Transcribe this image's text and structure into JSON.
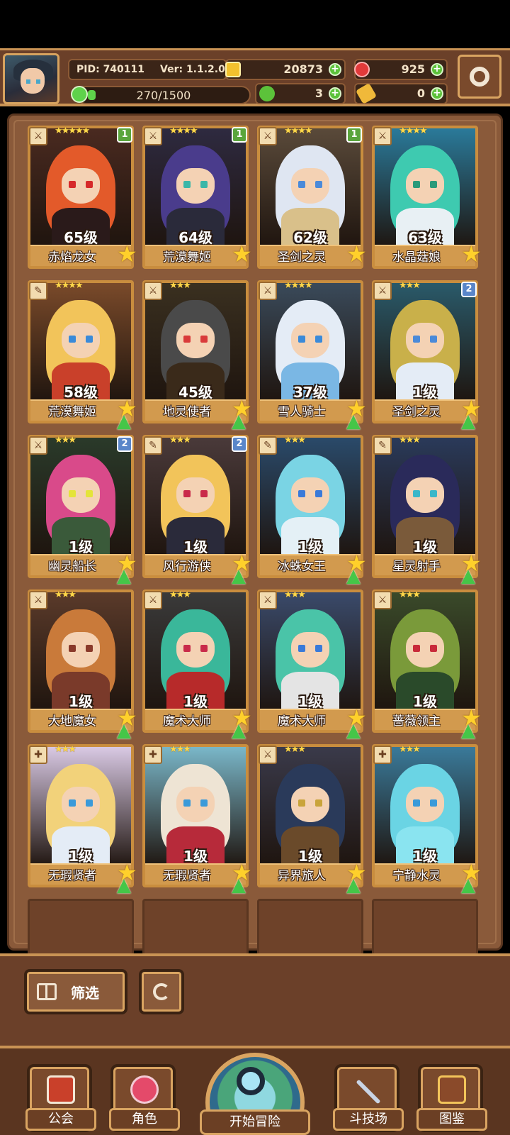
{
  "header": {
    "pid": "PID: 740111",
    "version": "Ver: 1.1.2.0",
    "gold": "20873",
    "gems": "925",
    "exp": "270/1500",
    "exp_progress": 0.18,
    "clover": "3",
    "key": "0",
    "colors": {
      "gold": "#f2c12e",
      "gem": "#e23a3a",
      "clover": "#5cc23a",
      "key": "#f0b93a"
    }
  },
  "heroes": [
    {
      "name": "赤焰龙女",
      "level": "65级",
      "stars": "★★★★★",
      "badge": "1",
      "badge_color": "green",
      "class_icon": "sword-icon",
      "hair": "#e35a2a",
      "eye": "#d62a2a",
      "outfit": "#2a1a1a",
      "bg": "#4a2a20"
    },
    {
      "name": "荒漠舞姬",
      "level": "64级",
      "stars": "★★★★",
      "badge": "1",
      "badge_color": "green",
      "class_icon": "sword-icon",
      "hair": "#4a3c8c",
      "eye": "#3ab7a8",
      "outfit": "#2a2a3a",
      "bg": "#2e2a40"
    },
    {
      "name": "圣剑之灵",
      "level": "62级",
      "stars": "★★★★",
      "badge": "1",
      "badge_color": "green",
      "class_icon": "sword-icon",
      "hair": "#dfe6f2",
      "eye": "#4a8ad9",
      "outfit": "#d9c08a",
      "bg": "#5a4a3a"
    },
    {
      "name": "水晶菇娘",
      "level": "63级",
      "stars": "★★★★",
      "badge": "",
      "badge_color": "",
      "class_icon": "sword-icon",
      "hair": "#3ecab0",
      "eye": "#2a9a7a",
      "outfit": "#e8f0f4",
      "bg": "#2a7a9a"
    },
    {
      "name": "荒漠舞姬",
      "level": "58级",
      "stars": "★★★★",
      "badge": "",
      "badge_color": "",
      "class_icon": "staff-icon",
      "hair": "#f2c45a",
      "eye": "#3a8ad9",
      "outfit": "#c9402a",
      "bg": "#7a4a2a"
    },
    {
      "name": "地灵使者",
      "level": "45级",
      "stars": "★★★",
      "badge": "",
      "badge_color": "",
      "class_icon": "sword-icon",
      "hair": "#4a4a4a",
      "eye": "#d93a3a",
      "outfit": "#3a2a1a",
      "bg": "#3a3020"
    },
    {
      "name": "雪人骑士",
      "level": "37级",
      "stars": "★★★★",
      "badge": "",
      "badge_color": "",
      "class_icon": "sword-icon",
      "hair": "#e4ecf6",
      "eye": "#3a8ad9",
      "outfit": "#7ab7e4",
      "bg": "#3a4a5a"
    },
    {
      "name": "圣剑之灵",
      "level": "1级",
      "stars": "★★★",
      "badge": "2",
      "badge_color": "blue",
      "class_icon": "sword-icon",
      "hair": "#c9b04a",
      "eye": "#4a8ad9",
      "outfit": "#e4ecf6",
      "bg": "#2a5a6a"
    },
    {
      "name": "幽灵船长",
      "level": "1级",
      "stars": "★★★",
      "badge": "2",
      "badge_color": "blue",
      "class_icon": "sword-icon",
      "hair": "#d94a8a",
      "eye": "#e4e43a",
      "outfit": "#3a5a3a",
      "bg": "#2a3a2a"
    },
    {
      "name": "风行游侠",
      "level": "1级",
      "stars": "★★★",
      "badge": "2",
      "badge_color": "blue",
      "class_icon": "staff-icon",
      "hair": "#f2c45a",
      "eye": "#c92a4a",
      "outfit": "#2a2a3a",
      "bg": "#4a3a3a"
    },
    {
      "name": "冰蛛女王",
      "level": "1级",
      "stars": "★★★",
      "badge": "",
      "badge_color": "",
      "class_icon": "staff-icon",
      "hair": "#7ad4e4",
      "eye": "#3a7ad9",
      "outfit": "#e4f0f6",
      "bg": "#2a4a6a"
    },
    {
      "name": "星灵射手",
      "level": "1级",
      "stars": "★★★",
      "badge": "",
      "badge_color": "",
      "class_icon": "staff-icon",
      "hair": "#2a2a5a",
      "eye": "#3ab7c9",
      "outfit": "#7a5a3a",
      "bg": "#2a3a5a"
    },
    {
      "name": "大地魔女",
      "level": "1级",
      "stars": "★★★",
      "badge": "",
      "badge_color": "",
      "class_icon": "sword-icon",
      "hair": "#c97a3a",
      "eye": "#8a3a2a",
      "outfit": "#7a3a2a",
      "bg": "#5a3a2a"
    },
    {
      "name": "魔术大师",
      "level": "1级",
      "stars": "★★★",
      "badge": "",
      "badge_color": "",
      "class_icon": "sword-icon",
      "hair": "#3ab79a",
      "eye": "#c92a4a",
      "outfit": "#b72a2a",
      "bg": "#3a3a3a"
    },
    {
      "name": "魔术大师",
      "level": "1级",
      "stars": "★★★",
      "badge": "",
      "badge_color": "",
      "class_icon": "sword-icon",
      "hair": "#4ac4a8",
      "eye": "#3a7ad9",
      "outfit": "#e4e4e4",
      "bg": "#3a4a6a"
    },
    {
      "name": "蔷薇领主",
      "level": "1级",
      "stars": "★★★",
      "badge": "",
      "badge_color": "",
      "class_icon": "sword-icon",
      "hair": "#7a9a3a",
      "eye": "#c92a3a",
      "outfit": "#2a4a2a",
      "bg": "#3a4a2a"
    },
    {
      "name": "无瑕贤者",
      "level": "1级",
      "stars": "★★★",
      "badge": "",
      "badge_color": "",
      "class_icon": "cross-icon",
      "hair": "#f2d27a",
      "eye": "#3a9ad9",
      "outfit": "#e4ecf6",
      "bg": "#d9c9e4"
    },
    {
      "name": "无瑕贤者",
      "level": "1级",
      "stars": "★★★",
      "badge": "",
      "badge_color": "",
      "class_icon": "cross-icon",
      "hair": "#eee4d4",
      "eye": "#3a9ad9",
      "outfit": "#b72a3a",
      "bg": "#7ab7c9"
    },
    {
      "name": "异界旅人",
      "level": "1级",
      "stars": "★★★",
      "badge": "",
      "badge_color": "",
      "class_icon": "sword-icon",
      "hair": "#2a3a5a",
      "eye": "#c9a43a",
      "outfit": "#6a4a2a",
      "bg": "#3a3a4a"
    },
    {
      "name": "宁静水灵",
      "level": "1级",
      "stars": "★★★",
      "badge": "",
      "badge_color": "",
      "class_icon": "cross-icon",
      "hair": "#6ad4e4",
      "eye": "#3a9ad9",
      "outfit": "#8ae4f0",
      "bg": "#3a7a9a"
    }
  ],
  "controls": {
    "filter_label": "筛选",
    "reset_icon": "refresh-icon"
  },
  "nav": {
    "guild": "公会",
    "character": "角色",
    "adventure": "开始冒险",
    "arena": "斗技场",
    "codex": "图鉴"
  }
}
